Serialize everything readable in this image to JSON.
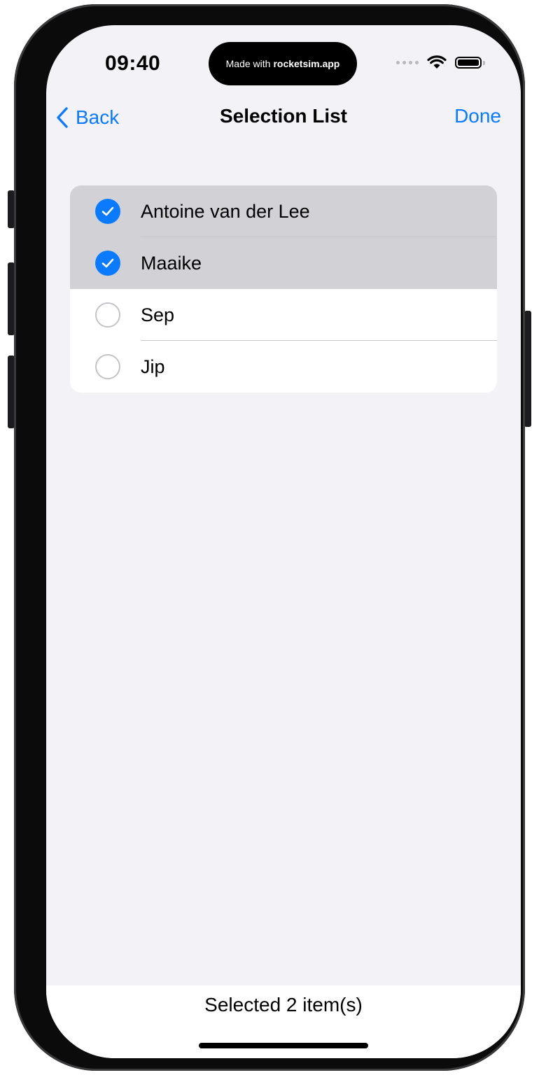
{
  "status_bar": {
    "time": "09:40",
    "island_prefix": "Made with",
    "island_brand": "rocketsim.app"
  },
  "nav": {
    "back_label": "Back",
    "title": "Selection List",
    "done_label": "Done"
  },
  "list": {
    "items": [
      {
        "label": "Antoine van der Lee",
        "selected": true
      },
      {
        "label": "Maaike",
        "selected": true
      },
      {
        "label": "Sep",
        "selected": false
      },
      {
        "label": "Jip",
        "selected": false
      }
    ]
  },
  "footer": {
    "text": "Selected 2 item(s)"
  },
  "colors": {
    "accent": "#0a7aff",
    "selected_row": "#d1d1d6",
    "background": "#f2f2f7"
  },
  "icons": [
    "chevron-left-icon",
    "checkmark-circle-icon",
    "empty-circle-icon",
    "wifi-icon",
    "battery-icon",
    "cellular-icon"
  ]
}
